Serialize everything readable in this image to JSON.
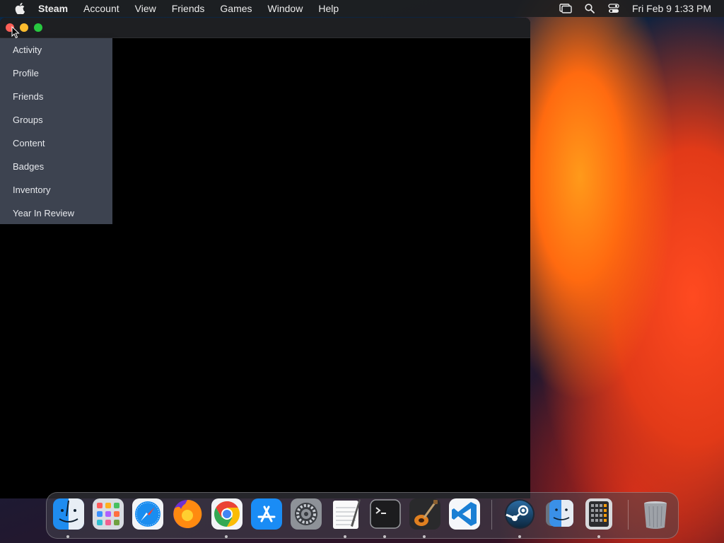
{
  "menubar": {
    "app_name": "Steam",
    "items": [
      "Account",
      "View",
      "Friends",
      "Games",
      "Window",
      "Help"
    ],
    "clock": "Fri Feb 9  1:33 PM",
    "status_icons": [
      "screen-mirroring-icon",
      "spotlight-search-icon",
      "control-center-icon"
    ]
  },
  "window": {
    "traffic_lights": [
      "close",
      "minimize",
      "zoom"
    ],
    "dropdown": {
      "items": [
        "Activity",
        "Profile",
        "Friends",
        "Groups",
        "Content",
        "Badges",
        "Inventory",
        "Year In Review"
      ]
    }
  },
  "dock": {
    "apps": [
      {
        "name": "finder-icon",
        "running": true
      },
      {
        "name": "launchpad-icon",
        "running": false
      },
      {
        "name": "safari-icon",
        "running": false
      },
      {
        "name": "firefox-icon",
        "running": false
      },
      {
        "name": "chrome-icon",
        "running": true
      },
      {
        "name": "app-store-icon",
        "running": false
      },
      {
        "name": "system-settings-icon",
        "running": false
      },
      {
        "name": "textedit-icon",
        "running": true
      },
      {
        "name": "terminal-icon",
        "running": true
      },
      {
        "name": "garageband-icon",
        "running": true
      },
      {
        "name": "vscode-icon",
        "running": false
      },
      {
        "name": "steam-icon",
        "running": true
      },
      {
        "name": "finder-alt-icon",
        "running": false
      },
      {
        "name": "calculator-icon",
        "running": true
      },
      {
        "name": "trash-icon",
        "running": false
      }
    ]
  },
  "colors": {
    "menubar_bg": "#1e1e20",
    "dropdown_bg": "#3d4350",
    "window_bg": "#000000"
  }
}
